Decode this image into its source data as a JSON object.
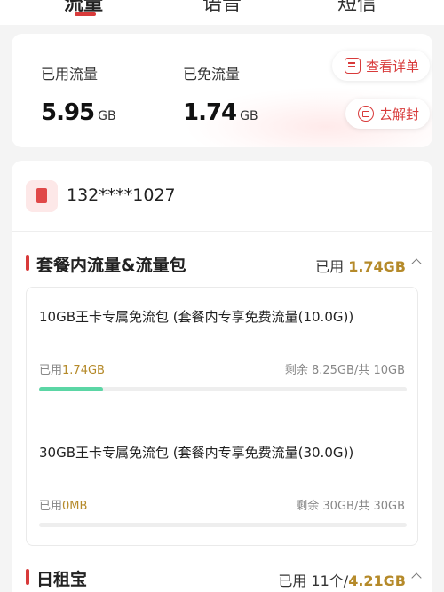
{
  "tabs": [
    {
      "label": "流量"
    },
    {
      "label": "语音"
    },
    {
      "label": "短信"
    }
  ],
  "summary": {
    "used_label": "已用流量",
    "used_value": "5.95",
    "used_unit": "GB",
    "free_label": "已免流量",
    "free_value": "1.74",
    "free_unit": "GB",
    "detail_button": "查看详单",
    "unlock_button": "去解封"
  },
  "account": {
    "phone": "132****1027"
  },
  "section_package": {
    "title": "套餐内流量&流量包",
    "used_prefix": "已用",
    "used_amount": "1.74GB",
    "packages": [
      {
        "name": "10GB王卡专属免流包 (套餐内专享免费流量(10.0G))",
        "used_prefix": "已用",
        "used_value": "1.74GB",
        "remain": "剩余 8.25GB/共 10GB",
        "progress_percent": 17.4
      },
      {
        "name": "30GB王卡专属免流包 (套餐内专享免费流量(30.0G))",
        "used_prefix": "已用",
        "used_value": "0MB",
        "remain": "剩余 30GB/共 30GB",
        "progress_percent": 0
      }
    ]
  },
  "section_daily": {
    "title": "日租宝",
    "used_prefix": "已用 11个/",
    "used_amount": "4.21GB"
  },
  "colors": {
    "accent": "#d83a3a",
    "gold": "#b58a2a",
    "progress": "#5bd6a5"
  }
}
